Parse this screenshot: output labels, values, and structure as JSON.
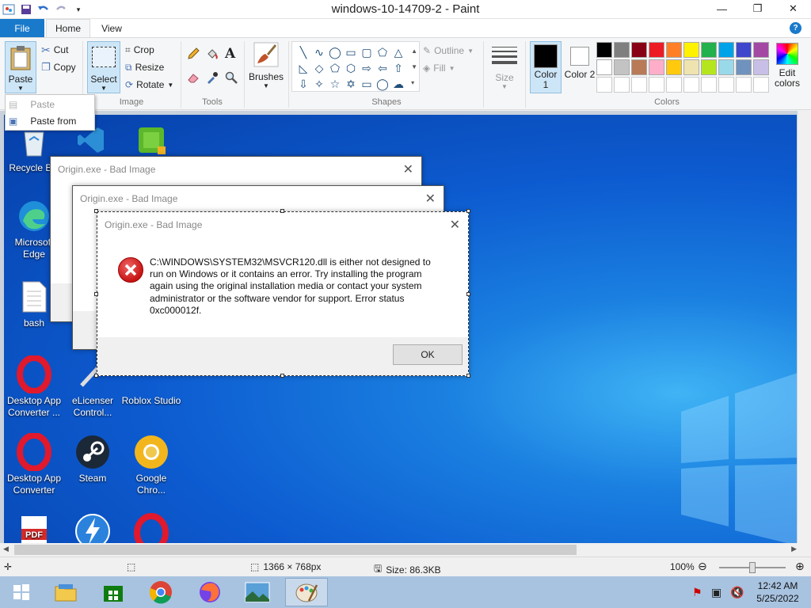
{
  "window": {
    "title": "windows-10-14709-2 - Paint",
    "minimize": "—",
    "restore": "❐",
    "close": "✕"
  },
  "tabs": {
    "file": "File",
    "home": "Home",
    "view": "View",
    "help": "?"
  },
  "clipboard": {
    "paste": "Paste",
    "cut": "Cut",
    "copy": "Copy"
  },
  "image": {
    "select": "Select",
    "crop": "Crop",
    "resize": "Resize",
    "rotate": "Rotate",
    "group": "Image"
  },
  "tools": {
    "group": "Tools",
    "text_tool": "A"
  },
  "brushes": {
    "label": "Brushes"
  },
  "shapes": {
    "group": "Shapes",
    "outline": "Outline",
    "fill": "Fill"
  },
  "size": {
    "label": "Size"
  },
  "colors": {
    "group": "Colors",
    "color1": "Color 1",
    "color2": "Color 2",
    "edit": "Edit colors",
    "color1_value": "#000000",
    "color2_value": "#ffffff",
    "palette": [
      "#000000",
      "#7f7f7f",
      "#880015",
      "#ed1c24",
      "#ff7f27",
      "#fff200",
      "#22b14c",
      "#00a2e8",
      "#3f48cc",
      "#a349a4",
      "#ffffff",
      "#c3c3c3",
      "#b97a57",
      "#ffaec9",
      "#ffc90e",
      "#efe4b0",
      "#b5e61d",
      "#99d9ea",
      "#7092be",
      "#c8bfe7",
      "#ffffff",
      "#ffffff",
      "#ffffff",
      "#ffffff",
      "#ffffff",
      "#ffffff",
      "#ffffff",
      "#ffffff",
      "#ffffff",
      "#ffffff"
    ]
  },
  "paste_menu": {
    "paste": "Paste",
    "paste_from": "Paste from"
  },
  "desktop": {
    "icons": [
      {
        "label": "Recycle Bin"
      },
      {
        "label": "Microsoft Edge"
      },
      {
        "label": "bash"
      },
      {
        "label": "Desktop App Converter ..."
      },
      {
        "label": "eLicenser Control..."
      },
      {
        "label": "Roblox Studio"
      },
      {
        "label": "Desktop App Converter"
      },
      {
        "label": "Steam"
      },
      {
        "label": "Google Chro..."
      },
      {
        "label": "PDF"
      }
    ]
  },
  "dialog": {
    "title": "Origin.exe - Bad Image",
    "message": "C:\\WINDOWS\\SYSTEM32\\MSVCR120.dll is either not designed to run on Windows or it contains an error. Try installing the program again using the original installation media or contact your system administrator or the software vendor for support. Error status 0xc000012f.",
    "ok": "OK",
    "close": "✕"
  },
  "status": {
    "dimensions": "1366 × 768px",
    "size": "Size: 86.3KB",
    "zoom": "100%"
  },
  "taskbar": {
    "time": "12:42 AM",
    "date": "5/25/2022"
  }
}
